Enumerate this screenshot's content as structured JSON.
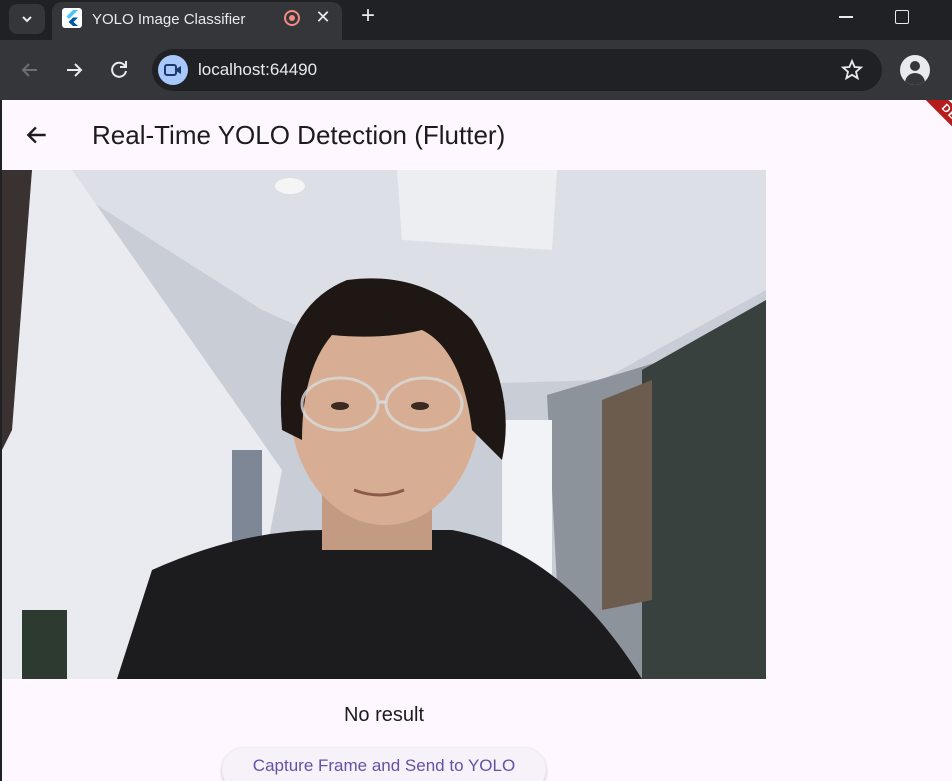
{
  "browser": {
    "tab_title": "YOLO Image Classifier",
    "tab_close": "✕",
    "new_tab": "+",
    "url": "localhost:64490"
  },
  "app": {
    "title": "Real-Time YOLO Detection (Flutter)",
    "debug_banner": "DEBUG",
    "result_text": "No result",
    "capture_button": "Capture Frame and Send to YOLO"
  }
}
